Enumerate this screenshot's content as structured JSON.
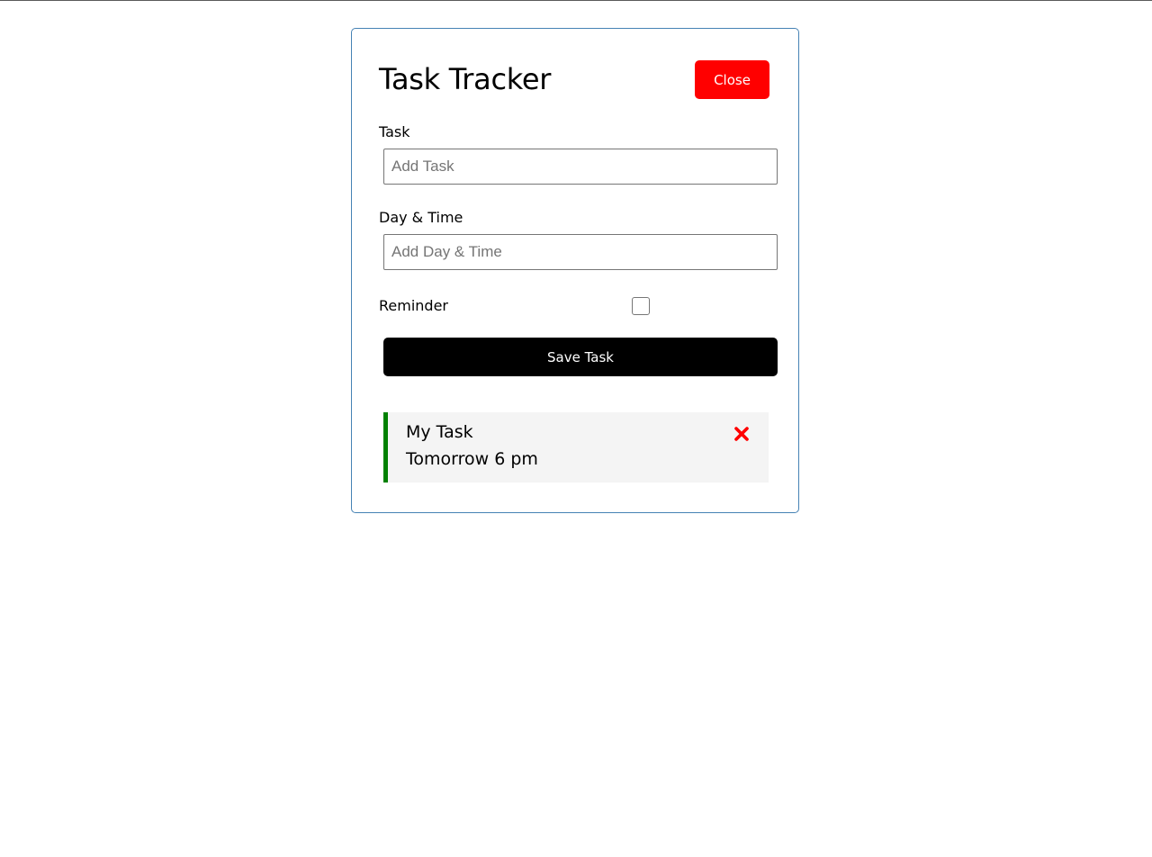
{
  "header": {
    "title": "Task Tracker",
    "close_label": "Close"
  },
  "form": {
    "task_label": "Task",
    "task_placeholder": "Add Task",
    "task_value": "",
    "day_label": "Day & Time",
    "day_placeholder": "Add Day & Time",
    "day_value": "",
    "reminder_label": "Reminder",
    "reminder_checked": false,
    "save_label": "Save Task"
  },
  "tasks": [
    {
      "text": "My Task",
      "day": "Tomorrow 6 pm",
      "reminder": true,
      "delete_icon": "close-icon"
    }
  ],
  "colors": {
    "close_button": "#ff0000",
    "save_button": "#000000",
    "reminder_border": "#008000",
    "delete_icon": "#ff0000",
    "container_border": "#4682b4",
    "task_background": "#f4f4f4"
  }
}
